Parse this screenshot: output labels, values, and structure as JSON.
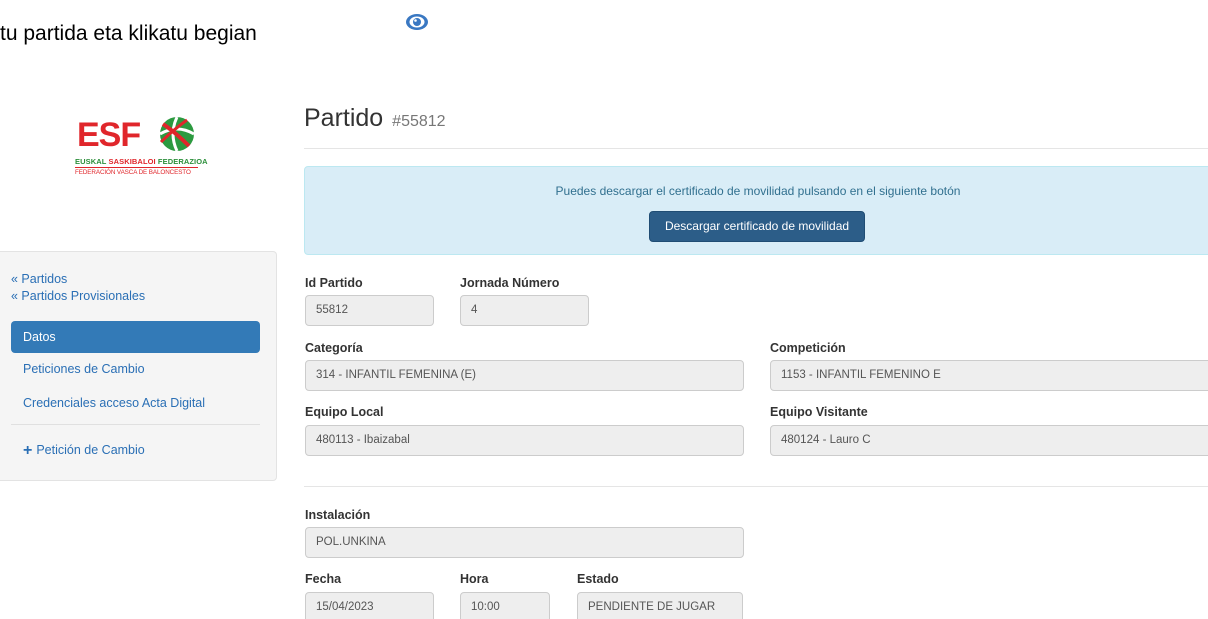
{
  "instruction": {
    "text": "tu partida eta klikatu begian",
    "icon": "eye-icon"
  },
  "logo": {
    "abbr": "ESF",
    "line1_a": "EUSKAL ",
    "line1_b": "SASKIBALOI",
    "line1_c": " FEDERAZIOA",
    "line2": "FEDERACIÓN VASCA DE BALONCESTO"
  },
  "sidebar": {
    "links": [
      "« Partidos",
      "« Partidos Provisionales"
    ],
    "nav": [
      {
        "label": "Datos",
        "active": true
      },
      {
        "label": "Peticiones de Cambio",
        "active": false
      },
      {
        "label": "Credenciales acceso Acta Digital",
        "active": false
      }
    ],
    "action": {
      "icon": "plus-icon",
      "label": "Petición de Cambio"
    }
  },
  "header": {
    "title": "Partido",
    "id": "#55812"
  },
  "alert": {
    "text": "Puedes descargar el certificado de movilidad pulsando en el siguiente botón",
    "button": "Descargar certificado de movilidad"
  },
  "form": {
    "id_partido": {
      "label": "Id Partido",
      "value": "55812"
    },
    "jornada": {
      "label": "Jornada Número",
      "value": "4"
    },
    "categoria": {
      "label": "Categoría",
      "value": "314 - INFANTIL FEMENINA (E)"
    },
    "competicion": {
      "label": "Competición",
      "value": "1153 - INFANTIL FEMENINO E"
    },
    "equipo_local": {
      "label": "Equipo Local",
      "value": "480113  - Ibaizabal"
    },
    "equipo_visitante": {
      "label": "Equipo Visitante",
      "value": "480124  - Lauro C"
    },
    "instalacion": {
      "label": "Instalación",
      "value": "POL.UNKINA"
    },
    "fecha": {
      "label": "Fecha",
      "value": "15/04/2023"
    },
    "hora": {
      "label": "Hora",
      "value": "10:00"
    },
    "estado": {
      "label": "Estado",
      "value": "PENDIENTE DE JUGAR"
    }
  },
  "colors": {
    "brand_red": "#e0262b",
    "brand_green": "#2c8f3b",
    "primary": "#337ab7",
    "alert_bg": "#d9edf7",
    "button_dark": "#2c5d88"
  }
}
